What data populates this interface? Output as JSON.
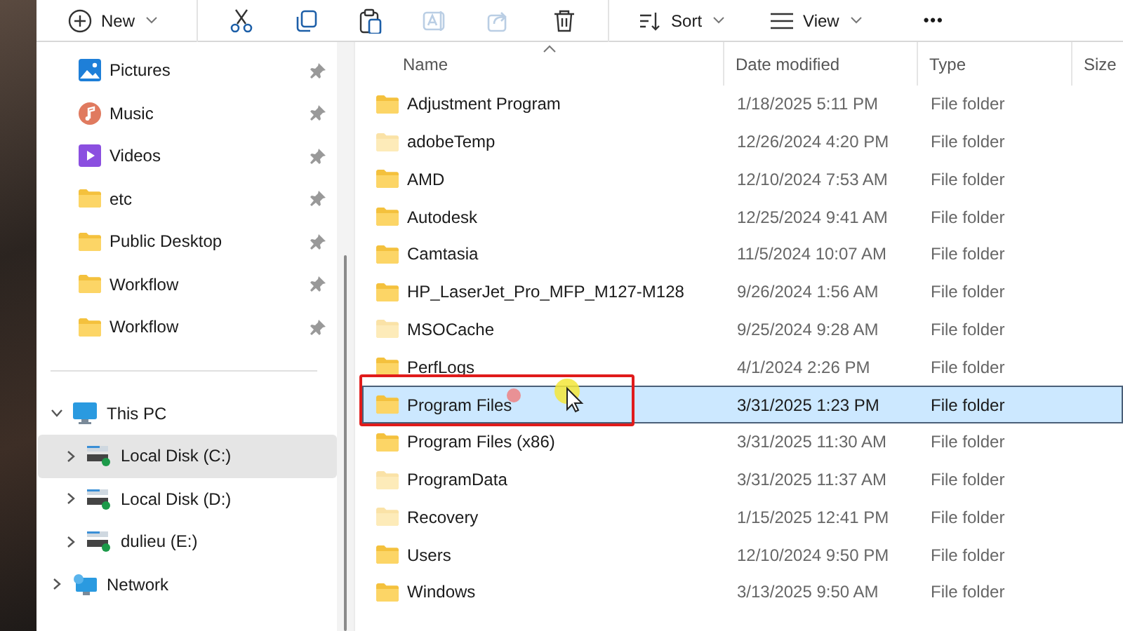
{
  "toolbar": [
    {
      "kind": "new",
      "label": "New",
      "disabled": false
    },
    {
      "kind": "cut",
      "disabled": false
    },
    {
      "kind": "copy",
      "disabled": false
    },
    {
      "kind": "paste",
      "disabled": false
    },
    {
      "kind": "rename",
      "disabled": true
    },
    {
      "kind": "share",
      "disabled": true
    },
    {
      "kind": "delete",
      "disabled": false
    },
    {
      "kind": "sort",
      "label": "Sort",
      "disabled": false
    },
    {
      "kind": "view",
      "label": "View",
      "disabled": false
    },
    {
      "kind": "more",
      "label": "•••",
      "disabled": false
    }
  ],
  "sidebar": {
    "quick_access": [
      {
        "label": "Pictures",
        "kind": "pictures",
        "pinned": true
      },
      {
        "label": "Music",
        "kind": "music",
        "pinned": true
      },
      {
        "label": "Videos",
        "kind": "videos",
        "pinned": true
      },
      {
        "label": "etc",
        "kind": "folder",
        "pinned": true
      },
      {
        "label": "Public Desktop",
        "kind": "folder",
        "pinned": true
      },
      {
        "label": "Workflow",
        "kind": "folder",
        "pinned": true
      },
      {
        "label": "Workflow",
        "kind": "folder",
        "pinned": true
      }
    ],
    "tree": [
      {
        "label": "This PC",
        "kind": "pc",
        "expanded": true,
        "selected": false,
        "children": [
          {
            "label": "Local Disk (C:)",
            "kind": "drive",
            "expanded": false,
            "selected": true
          },
          {
            "label": "Local Disk (D:)",
            "kind": "drive",
            "expanded": false,
            "selected": false
          },
          {
            "label": "dulieu (E:)",
            "kind": "drive",
            "expanded": false,
            "selected": false
          }
        ]
      },
      {
        "label": "Network",
        "kind": "network",
        "expanded": false,
        "selected": false
      }
    ]
  },
  "table": {
    "columns": [
      {
        "label": "Name",
        "sorted": true
      },
      {
        "label": "Date modified",
        "sorted": false
      },
      {
        "label": "Type",
        "sorted": false
      },
      {
        "label": "Size",
        "sorted": false
      }
    ],
    "rows": [
      {
        "name": "Adjustment Program",
        "date": "1/18/2025 5:11 PM",
        "type": "File folder",
        "hidden": false,
        "selected": false,
        "outlined": false
      },
      {
        "name": "adobeTemp",
        "date": "12/26/2024 4:20 PM",
        "type": "File folder",
        "hidden": true,
        "selected": false,
        "outlined": false
      },
      {
        "name": "AMD",
        "date": "12/10/2024 7:53 AM",
        "type": "File folder",
        "hidden": false,
        "selected": false,
        "outlined": false
      },
      {
        "name": "Autodesk",
        "date": "12/25/2024 9:41 AM",
        "type": "File folder",
        "hidden": false,
        "selected": false,
        "outlined": false
      },
      {
        "name": "Camtasia",
        "date": "11/5/2024 10:07 AM",
        "type": "File folder",
        "hidden": false,
        "selected": false,
        "outlined": false
      },
      {
        "name": "HP_LaserJet_Pro_MFP_M127-M128",
        "date": "9/26/2024 1:56 AM",
        "type": "File folder",
        "hidden": false,
        "selected": false,
        "outlined": false
      },
      {
        "name": "MSOCache",
        "date": "9/25/2024 9:28 AM",
        "type": "File folder",
        "hidden": true,
        "selected": false,
        "outlined": false
      },
      {
        "name": "PerfLogs",
        "date": "4/1/2024 2:26 PM",
        "type": "File folder",
        "hidden": false,
        "selected": false,
        "outlined": false
      },
      {
        "name": "Program Files",
        "date": "3/31/2025 1:23 PM",
        "type": "File folder",
        "hidden": false,
        "selected": true,
        "outlined": true
      },
      {
        "name": "Program Files (x86)",
        "date": "3/31/2025 11:30 AM",
        "type": "File folder",
        "hidden": false,
        "selected": false,
        "outlined": false
      },
      {
        "name": "ProgramData",
        "date": "3/31/2025 11:37 AM",
        "type": "File folder",
        "hidden": true,
        "selected": false,
        "outlined": false
      },
      {
        "name": "Recovery",
        "date": "1/15/2025 12:41 PM",
        "type": "File folder",
        "hidden": true,
        "selected": false,
        "outlined": false
      },
      {
        "name": "Users",
        "date": "12/10/2024 9:50 PM",
        "type": "File folder",
        "hidden": false,
        "selected": false,
        "outlined": false
      },
      {
        "name": "Windows",
        "date": "3/13/2025 9:50 AM",
        "type": "File folder",
        "hidden": false,
        "selected": false,
        "outlined": false
      }
    ]
  }
}
